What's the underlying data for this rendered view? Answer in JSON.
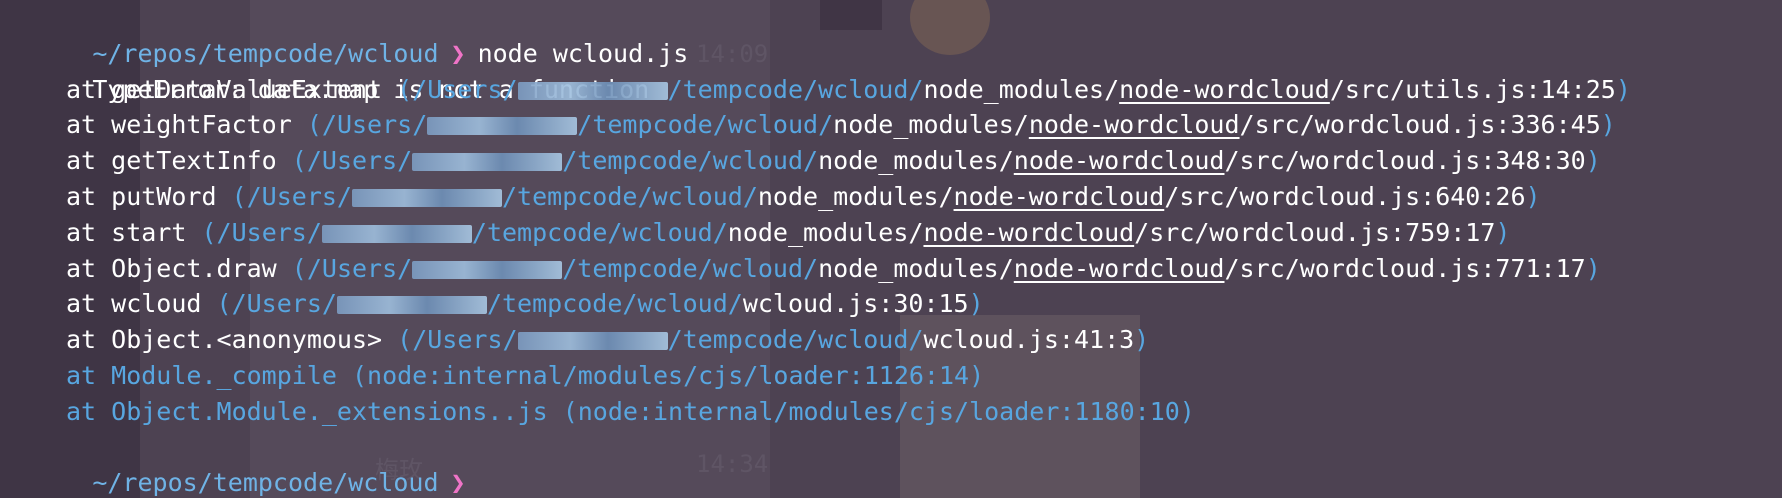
{
  "terminal": {
    "cwd": "~/repos/tempcode/wcloud",
    "prompt_symbol": "❯",
    "command": "node wcloud.js",
    "error_message": "TypeError: data.map is not a function",
    "stack": [
      {
        "prefix": "at ",
        "fn": "getDataValueExtent",
        "users": "(/Users/",
        "rest_dim": "/tempcode/wcloud/",
        "mod": "node_modules/",
        "pkg": "node-wordcloud",
        "file": "/src/utils.js:14:25",
        "close": ")"
      },
      {
        "prefix": "at ",
        "fn": "weightFactor",
        "users": "(/Users/",
        "rest_dim": "/tempcode/wcloud/",
        "mod": "node_modules/",
        "pkg": "node-wordcloud",
        "file": "/src/wordcloud.js:336:45",
        "close": ")"
      },
      {
        "prefix": "at ",
        "fn": "getTextInfo",
        "users": "(/Users/",
        "rest_dim": "/tempcode/wcloud/",
        "mod": "node_modules/",
        "pkg": "node-wordcloud",
        "file": "/src/wordcloud.js:348:30",
        "close": ")"
      },
      {
        "prefix": "at ",
        "fn": "putWord",
        "users": "(/Users/",
        "rest_dim": "/tempcode/wcloud/",
        "mod": "node_modules/",
        "pkg": "node-wordcloud",
        "file": "/src/wordcloud.js:640:26",
        "close": ")"
      },
      {
        "prefix": "at ",
        "fn": "start",
        "users": "(/Users/",
        "rest_dim": "/tempcode/wcloud/",
        "mod": "node_modules/",
        "pkg": "node-wordcloud",
        "file": "/src/wordcloud.js:759:17",
        "close": ")"
      },
      {
        "prefix": "at ",
        "fn": "Object.draw",
        "users": "(/Users/",
        "rest_dim": "/tempcode/wcloud/",
        "mod": "node_modules/",
        "pkg": "node-wordcloud",
        "file": "/src/wordcloud.js:771:17",
        "close": ")"
      }
    ],
    "stack_local": [
      {
        "prefix": "at ",
        "fn": "wcloud",
        "users": "(/Users/",
        "rest_dim": "/tempcode/wcloud/",
        "file": "wcloud.js:30:15",
        "close": ")"
      },
      {
        "prefix": "at ",
        "fn": "Object.<anonymous>",
        "users": "(/Users/",
        "rest_dim": "/tempcode/wcloud/",
        "file": "wcloud.js:41:3",
        "close": ")"
      }
    ],
    "stack_internal": [
      "at Module._compile (node:internal/modules/cjs/loader:1126:14)",
      "at Object.Module._extensions..js (node:internal/modules/cjs/loader:1180:10)"
    ],
    "final_prompt_cwd": "~/repos/tempcode/wcloud",
    "final_prompt_symbol": "❯"
  },
  "background": {
    "ghost_texts": [
      "14:09",
      "14:34",
      "梅玫"
    ]
  },
  "colors": {
    "background": "#4d4252",
    "cwd": "#6fb3e6",
    "prompt": "#ef74c7",
    "dim_path": "#58a6e0",
    "text": "#ffffff"
  }
}
